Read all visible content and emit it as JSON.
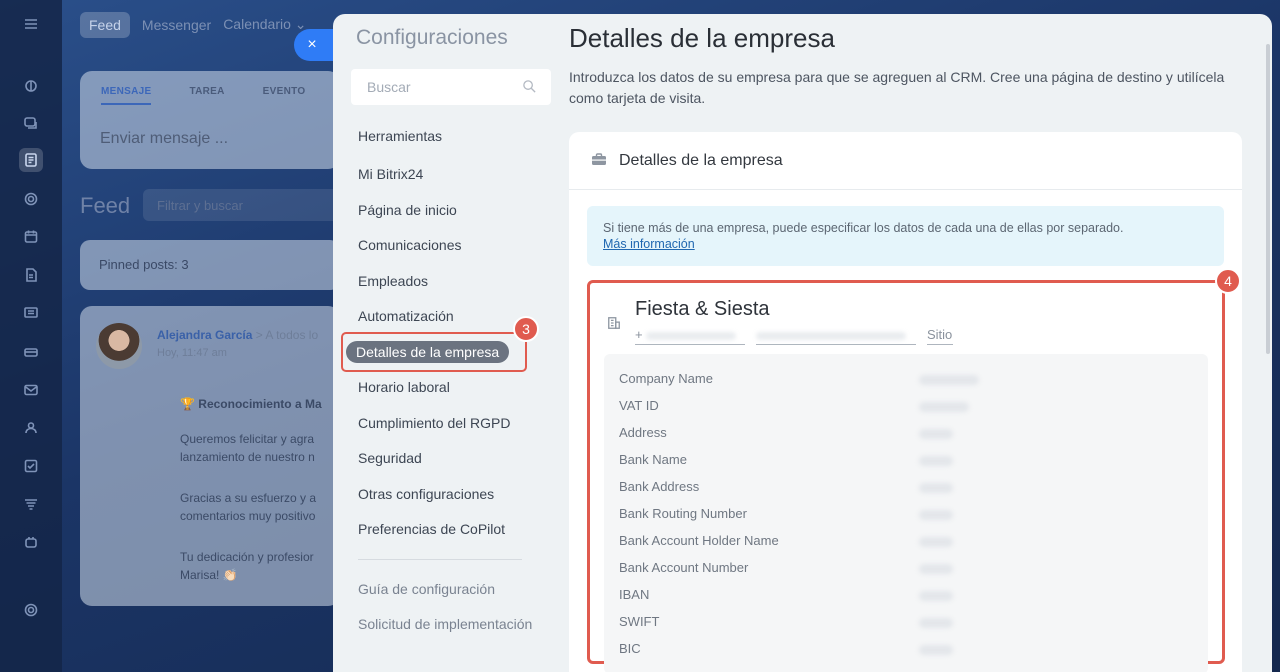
{
  "background": {
    "top_nav": [
      "Feed",
      "Messenger",
      "Calendario ⌄"
    ],
    "composer": {
      "tabs": [
        "MENSAJE",
        "TAREA",
        "EVENTO"
      ],
      "placeholder": "Enviar mensaje ..."
    },
    "feed_title": "Feed",
    "feed_filter_placeholder": "Filtrar y buscar",
    "pinned": "Pinned posts: 3",
    "post": {
      "author": "Alejandra García",
      "recipients": "> A todos lo",
      "time": "Hoy, 11:47 am",
      "lines": [
        "🏆 Reconocimiento a Ma",
        "Queremos felicitar y agra",
        "lanzamiento de nuestro n",
        "Gracias a su esfuerzo y a",
        "comentarios muy positivo",
        "Tu dedicación y profesior",
        "Marisa! 👏🏻"
      ]
    }
  },
  "close_button": "×",
  "settings_nav": {
    "title": "Configuraciones",
    "search_placeholder": "Buscar",
    "items": [
      "Herramientas",
      "Mi Bitrix24",
      "Página de inicio",
      "Comunicaciones",
      "Empleados",
      "Automatización",
      "Detalles de la empresa",
      "Horario laboral",
      "Cumplimiento del RGPD",
      "Seguridad",
      "Otras configuraciones",
      "Preferencias de CoPilot"
    ],
    "active_item": "Detalles de la empresa",
    "footer_items": [
      "Guía de configuración",
      "Solicitud de implementación"
    ],
    "step_badge": "3"
  },
  "main": {
    "title": "Detalles de la empresa",
    "description": "Introduzca los datos de su empresa para que se agreguen al CRM. Cree una página de destino y utilícela como tarjeta de visita.",
    "card_title": "Detalles de la empresa",
    "info_text": "Si tiene más de una empresa, puede especificar los datos de cada una de ellas por separado.",
    "info_link": "Más información",
    "step_badge": "4",
    "company": {
      "name": "Fiesta & Siesta",
      "phone_prefix": "+",
      "site_label": "Sitio",
      "fields": [
        "Company Name",
        "VAT ID",
        "Address",
        "Bank Name",
        "Bank Address",
        "Bank Routing Number",
        "Bank Account Holder Name",
        "Bank Account Number",
        "IBAN",
        "SWIFT",
        "BIC"
      ]
    }
  },
  "colors": {
    "accent_blue": "#2f7cf6",
    "highlight_red": "#e05b4f",
    "info_bg": "#e5f5fb",
    "link": "#2067b0"
  }
}
